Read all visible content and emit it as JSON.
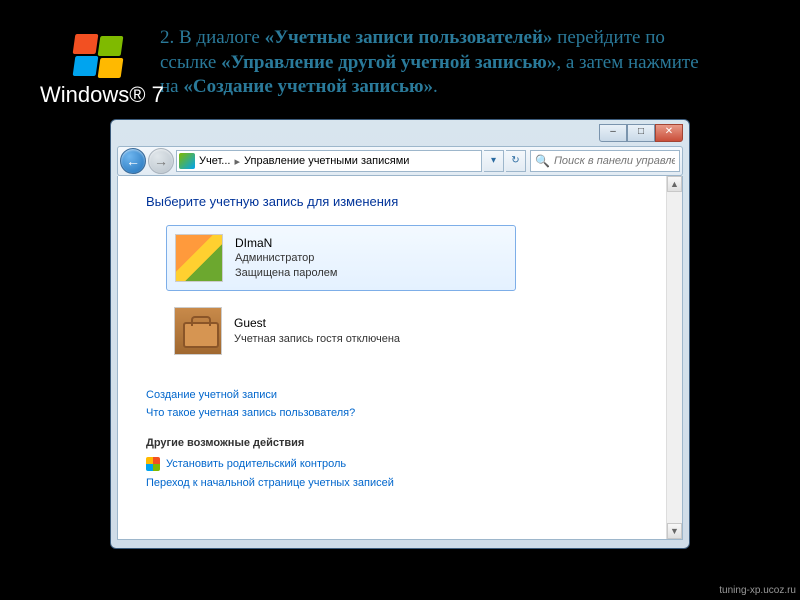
{
  "caption": {
    "prefix": "2. В диалоге ",
    "b1": "«Учетные записи пользователей»",
    "mid1": " перейдите по ссылке ",
    "b2": "«Управление другой учетной записью»",
    "mid2": ", а затем нажмите на ",
    "b3": "«Создание учетной записью»",
    "suffix": "."
  },
  "oslabel": "Windows® 7",
  "watermark": "tuning-xp.ucoz.ru",
  "window": {
    "buttons": {
      "min": "–",
      "max": "□",
      "close": "✕"
    },
    "breadcrumb": {
      "seg1": "Учет...",
      "seg2": "Управление учетными записями",
      "arrow": "▸"
    },
    "refresh": "↻",
    "search_placeholder": "Поиск в панели управления",
    "heading": "Выберите учетную запись для изменения",
    "accounts": [
      {
        "name": "DImaN",
        "line1": "Администратор",
        "line2": "Защищена паролем"
      },
      {
        "name": "Guest",
        "line1": "Учетная запись гостя отключена",
        "line2": ""
      }
    ],
    "links": {
      "create": "Создание учетной записи",
      "whatis": "Что такое учетная запись пользователя?",
      "section": "Другие возможные действия",
      "parental": "Установить родительский контроль",
      "gohome": "Переход к начальной странице учетных записей"
    }
  }
}
